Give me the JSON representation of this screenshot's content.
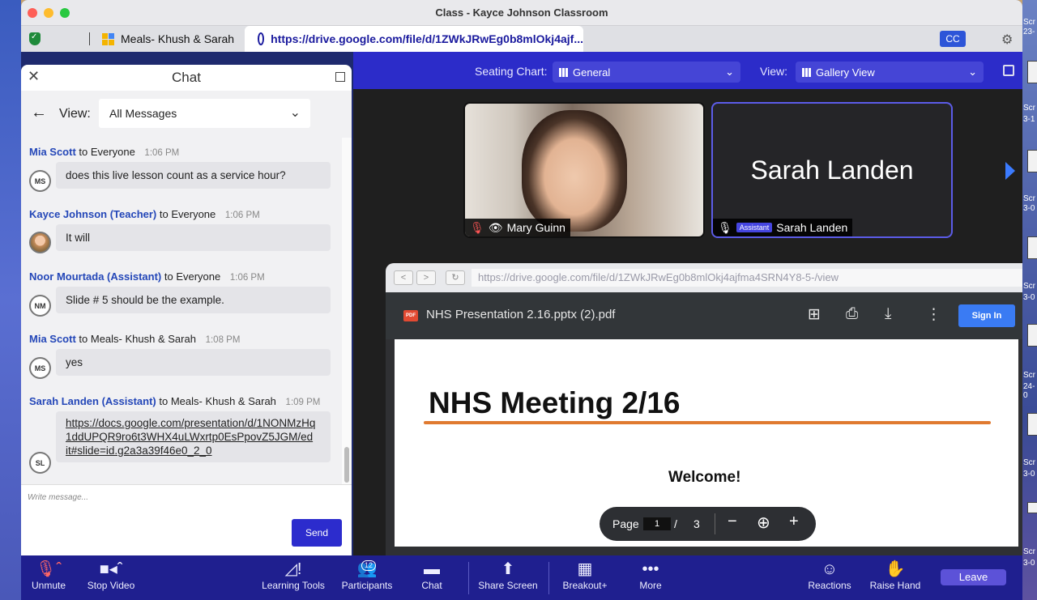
{
  "window": {
    "title": "Class - Kayce Johnson Classroom"
  },
  "tabs": {
    "tab1_label": "Meals- Khush & Sarah",
    "tab2_label": "https://drive.google.com/file/d/1ZWkJRwEg0b8mlOkj4ajf...",
    "cc_label": "CC"
  },
  "header": {
    "seating_label": "Seating Chart:",
    "seating_value": "General",
    "view_label": "View:",
    "view_value": "Gallery View"
  },
  "chat": {
    "title": "Chat",
    "view_label": "View:",
    "view_value": "All Messages",
    "messages": [
      {
        "sender": "Mia Scott",
        "to": "to Everyone",
        "time": "1:06 PM",
        "initials": "MS",
        "text": "does this live lesson count as a service hour?"
      },
      {
        "sender": "Kayce Johnson (Teacher)",
        "to": "to Everyone",
        "time": "1:06 PM",
        "initials": "",
        "text": "It will"
      },
      {
        "sender": "Noor Mourtada (Assistant)",
        "to": "to Everyone",
        "time": "1:06 PM",
        "initials": "NM",
        "text": "Slide # 5 should be the example."
      },
      {
        "sender": "Mia Scott",
        "to": "to Meals- Khush & Sarah",
        "time": "1:08 PM",
        "initials": "MS",
        "text": "yes"
      },
      {
        "sender": "Sarah Landen (Assistant)",
        "to": "to Meals- Khush & Sarah",
        "time": "1:09 PM",
        "initials": "SL",
        "link_lines": [
          "https://docs.google.com/presentation/d/1NONMzHq",
          "1ddUPQR9ro6t3WHX4uLWxrtp0EsPpovZ5JGM/ed",
          "it#slide=id.g2a3a39f46e0_2_0"
        ]
      }
    ],
    "placeholder": "Write message...",
    "send_label": "Send"
  },
  "participants": [
    {
      "name": "Mary Guinn"
    },
    {
      "name": "Sarah Landen",
      "role": "Assistant"
    }
  ],
  "shared_browser": {
    "url": "https://drive.google.com/file/d/1ZWkJRwEg0b8mlOkj4ajfma4SRN4Y8-5-/view",
    "pdf_title": "NHS Presentation 2.16.pptx (2).pdf",
    "pdf_icon_text": "PDF",
    "sign_in": "Sign In",
    "slide_heading": "NHS Meeting 2/16",
    "slide_welcome": "Welcome!",
    "page_label": "Page",
    "page_current": "1",
    "page_sep": "/",
    "page_total": "3"
  },
  "toolbar": {
    "unmute": "Unmute",
    "stop_video": "Stop Video",
    "learning_tools": "Learning Tools",
    "participants": "Participants",
    "participants_count": "12",
    "chat": "Chat",
    "share_screen": "Share Screen",
    "breakout": "Breakout+",
    "more": "More",
    "reactions": "Reactions",
    "raise_hand": "Raise Hand",
    "leave": "Leave"
  },
  "desktop_labels": [
    "Scr",
    "23-",
    "Scr",
    "3-1",
    "Scr",
    "3-0",
    "Scr",
    "3-0",
    "Scr",
    "24-0",
    "Scr",
    "3-0",
    "Scr",
    "3-0"
  ]
}
